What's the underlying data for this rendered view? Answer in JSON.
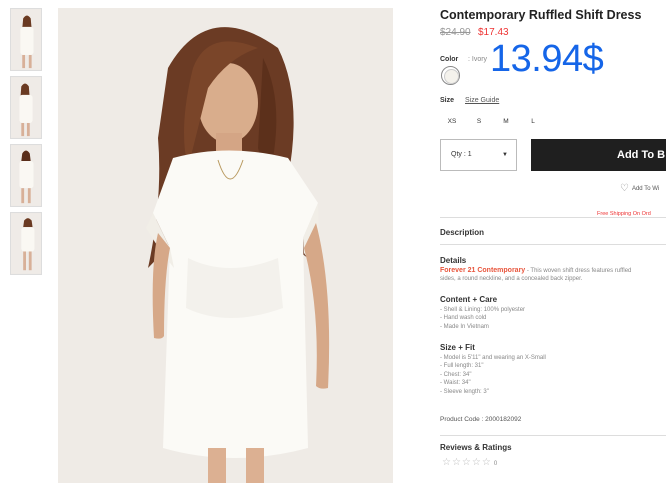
{
  "product": {
    "title": "Contemporary Ruffled Shift Dress",
    "old_price": "$24.90",
    "new_price": "$17.43",
    "overlay_price": "13.94$"
  },
  "color": {
    "label": "Color",
    "value": ": Ivory"
  },
  "size": {
    "label": "Size",
    "guide": "Size Guide",
    "options": [
      "XS",
      "S",
      "M",
      "L"
    ]
  },
  "cart": {
    "qty": "Qty : 1",
    "qty_caret": "▼",
    "add_label": "Add To B",
    "wishlist": "Add To Wi",
    "free_shipping": "Free Shipping On Ord"
  },
  "description": {
    "heading": "Description",
    "details_heading": "Details",
    "brand": "Forever 21 Contemporary",
    "details_line1": " - This woven shift dress features ruffled",
    "details_line2": "sides, a round neckline, and a concealed back zipper.",
    "content_heading": "Content + Care",
    "content_lines": [
      "- Shell & Lining: 100% polyester",
      "- Hand wash cold",
      "- Made In Vietnam"
    ],
    "fit_heading": "Size + Fit",
    "fit_lines": [
      "- Model is 5'11\" and wearing an X-Small",
      "- Full length: 31\"",
      "- Chest: 34\"",
      "- Waist: 34\"",
      "- Sleeve length: 3\""
    ],
    "product_code": "Product Code : 2000182092"
  },
  "reviews": {
    "heading": "Reviews & Ratings",
    "stars": "☆☆☆☆☆",
    "count": "0"
  },
  "icons": {
    "heart": "heart-outline-icon",
    "caret": "caret-down-icon"
  },
  "colors": {
    "accent_price": "#1565e8",
    "sale": "#e33333",
    "brand": "#e8553c",
    "button": "#1f1f1f"
  }
}
